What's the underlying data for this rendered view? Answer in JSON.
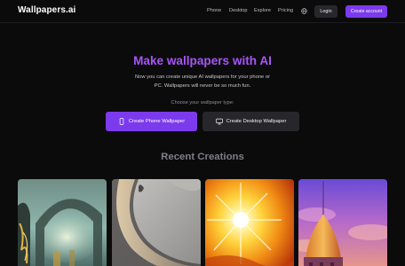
{
  "header": {
    "brand": "Wallpapers.ai",
    "nav": [
      "Phone",
      "Desktop",
      "Explore",
      "Pricing"
    ],
    "login_label": "Login",
    "create_account_label": "Create account"
  },
  "hero": {
    "title": "Make wallpapers with AI",
    "subtitle_line1": "Now you can create unique AI wallpapers for your phone or",
    "subtitle_line2": "PC. Wallpapers will never be so much fun.",
    "choose_label": "Choose your wallpaper type:",
    "phone_button_label": "Create Phone Wallpaper",
    "desktop_button_label": "Create Desktop Wallpaper"
  },
  "recent": {
    "title": "Recent Creations",
    "items": [
      {
        "name": "fantasy-arch-scene"
      },
      {
        "name": "abstract-grey-swirl"
      },
      {
        "name": "glowing-sun-burst"
      },
      {
        "name": "golden-palace-dome"
      }
    ]
  },
  "colors": {
    "accent": "#7c3aed",
    "title_purple": "#a855f7",
    "background": "#0b0b0c"
  }
}
